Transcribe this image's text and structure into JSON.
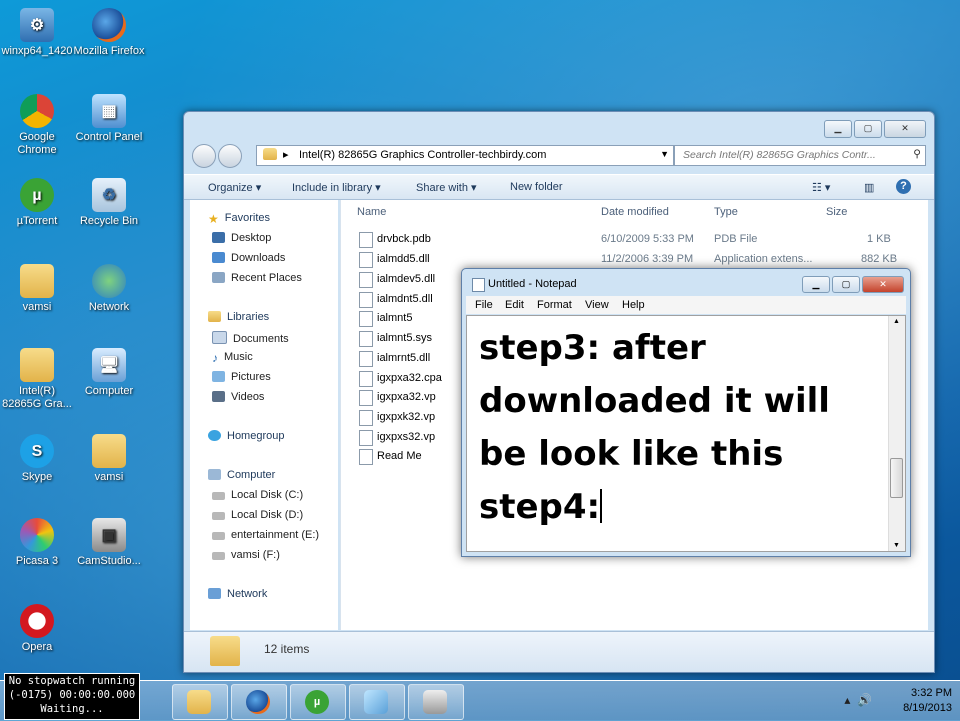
{
  "desktop": {
    "icons": [
      {
        "label": "winxp64_1420",
        "icon": "setup-icon"
      },
      {
        "label": "Mozilla Firefox",
        "icon": "firefox-icon"
      },
      {
        "label": "Google Chrome",
        "icon": "chrome-icon"
      },
      {
        "label": "Control Panel",
        "icon": "control-panel-icon"
      },
      {
        "label": "µTorrent",
        "icon": "utorrent-icon"
      },
      {
        "label": "Recycle Bin",
        "icon": "recycle-bin-icon"
      },
      {
        "label": "vamsi",
        "icon": "folder-icon"
      },
      {
        "label": "Network",
        "icon": "network-icon"
      },
      {
        "label": "Intel(R) 82865G Gra...",
        "icon": "folder-icon"
      },
      {
        "label": "Computer",
        "icon": "computer-icon"
      },
      {
        "label": "Skype",
        "icon": "skype-icon"
      },
      {
        "label": "vamsi",
        "icon": "folder-icon"
      },
      {
        "label": "Picasa 3",
        "icon": "picasa-icon"
      },
      {
        "label": "CamStudio...",
        "icon": "camstudio-icon"
      },
      {
        "label": "Opera",
        "icon": "opera-icon"
      }
    ]
  },
  "explorer": {
    "address": "Intel(R) 82865G Graphics Controller-techbirdy.com",
    "search_placeholder": "Search Intel(R) 82865G Graphics Contr...",
    "toolbar": {
      "organize": "Organize",
      "include": "Include in library",
      "share": "Share with",
      "new_folder": "New folder"
    },
    "nav": {
      "favorites": "Favorites",
      "desktop": "Desktop",
      "downloads": "Downloads",
      "recent": "Recent Places",
      "libraries": "Libraries",
      "documents": "Documents",
      "music": "Music",
      "pictures": "Pictures",
      "videos": "Videos",
      "homegroup": "Homegroup",
      "computer": "Computer",
      "disk_c": "Local Disk (C:)",
      "disk_d": "Local Disk (D:)",
      "disk_e": "entertainment (E:)",
      "disk_f": "vamsi (F:)",
      "network": "Network"
    },
    "columns": {
      "name": "Name",
      "date": "Date modified",
      "type": "Type",
      "size": "Size"
    },
    "files": [
      {
        "name": "drvbck.pdb",
        "date": "6/10/2009 5:33 PM",
        "type": "PDB File",
        "size": "1 KB"
      },
      {
        "name": "ialmdd5.dll",
        "date": "11/2/2006 3:39 PM",
        "type": "Application extens...",
        "size": "882 KB"
      },
      {
        "name": "ialmdev5.dll"
      },
      {
        "name": "ialmdnt5.dll"
      },
      {
        "name": "ialmnt5"
      },
      {
        "name": "ialmnt5.sys"
      },
      {
        "name": "ialmrnt5.dll"
      },
      {
        "name": "igxpxa32.cpa"
      },
      {
        "name": "igxpxa32.vp"
      },
      {
        "name": "igxpxk32.vp"
      },
      {
        "name": "igxpxs32.vp"
      },
      {
        "name": "Read Me"
      }
    ],
    "item_count": "12 items"
  },
  "notepad": {
    "title": "Untitled - Notepad",
    "menu": {
      "file": "File",
      "edit": "Edit",
      "format": "Format",
      "view": "View",
      "help": "Help"
    },
    "text": "step3: after\ndownloaded it will\nbe look like this\nstep4:"
  },
  "stopwatch": {
    "line1": "No stopwatch running",
    "line2": "(-0175)  00:00:00.000",
    "line3": "Waiting..."
  },
  "taskbar": {
    "time": "3:32 PM",
    "date": "8/19/2013"
  }
}
